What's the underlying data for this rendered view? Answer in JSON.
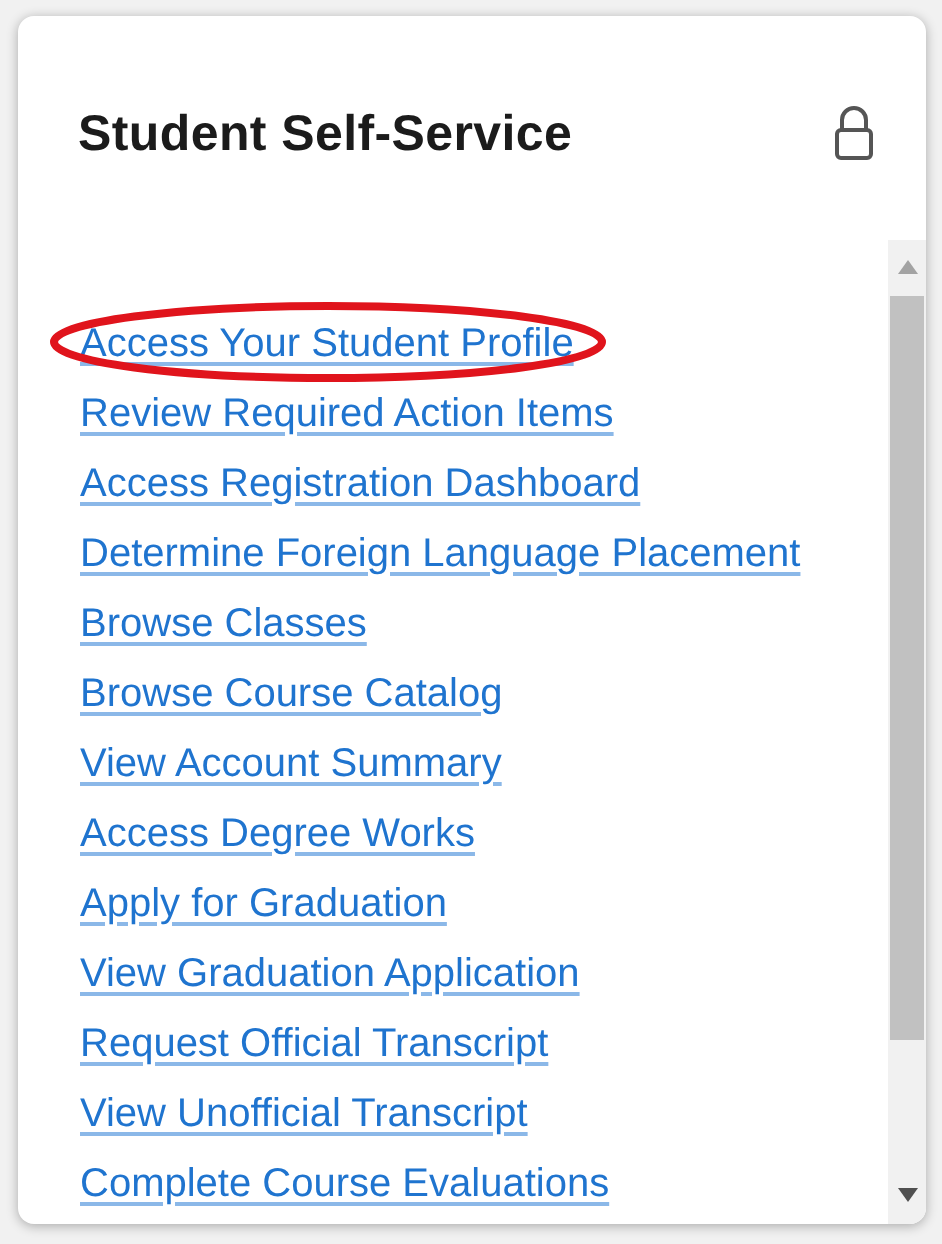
{
  "card": {
    "title": "Student Self-Service"
  },
  "links": [
    {
      "label": "Access Your Student Profile",
      "circled": true
    },
    {
      "label": "Review Required Action Items",
      "circled": false
    },
    {
      "label": "Access Registration Dashboard",
      "circled": false
    },
    {
      "label": "Determine Foreign Language Placement",
      "circled": false
    },
    {
      "label": "Browse Classes",
      "circled": false
    },
    {
      "label": "Browse Course Catalog",
      "circled": false
    },
    {
      "label": "View Account Summary",
      "circled": false
    },
    {
      "label": "Access Degree Works",
      "circled": false
    },
    {
      "label": "Apply for Graduation",
      "circled": false
    },
    {
      "label": "View Graduation Application",
      "circled": false
    },
    {
      "label": "Request Official Transcript",
      "circled": false
    },
    {
      "label": "View Unofficial Transcript",
      "circled": false
    },
    {
      "label": "Complete Course Evaluations",
      "circled": false
    }
  ]
}
